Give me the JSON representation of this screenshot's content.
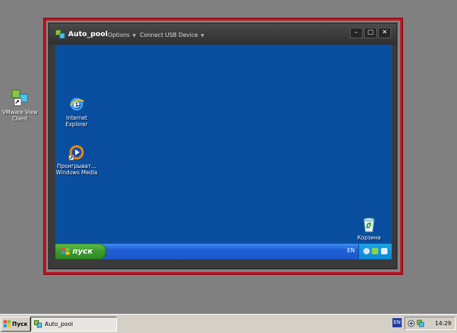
{
  "host_desktop": {
    "icons": [
      {
        "label": "VMware View Client",
        "icon": "vmware-view-client-icon"
      }
    ]
  },
  "client_window": {
    "pool_name": "Auto_pool",
    "menu": [
      {
        "label": "Options"
      },
      {
        "label": "Connect USB Device"
      }
    ],
    "window_buttons": {
      "minimize": "–",
      "maximize": "□",
      "close": "✕"
    }
  },
  "guest_desktop": {
    "icons": [
      {
        "label": "Internet Explorer",
        "icon": "internet-explorer-icon"
      },
      {
        "label": "Проигрыват... Windows Media",
        "icon": "windows-media-player-icon"
      },
      {
        "label": "Корзина",
        "icon": "recycle-bin-icon"
      }
    ],
    "taskbar": {
      "start_label": "пуск",
      "language": "EN"
    }
  },
  "host_taskbar": {
    "start_label": "Пуск",
    "task_label": "Auto_pool",
    "language": "EN",
    "clock": "14:29"
  },
  "colors": {
    "highlight_frame": "#c1121f",
    "guest_background": "#0a4f9f",
    "xp_start_green": "#3a9b2c",
    "host_background": "#808080"
  }
}
